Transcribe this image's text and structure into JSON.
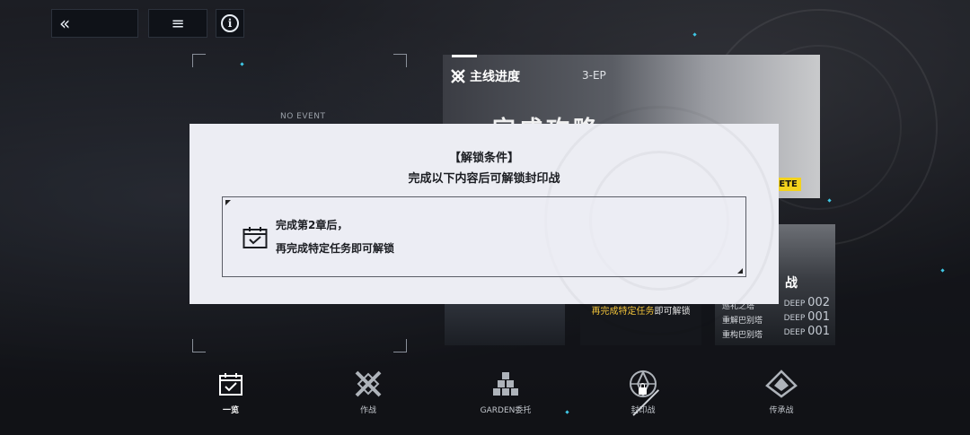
{
  "topbar": {
    "back_label": "«",
    "menu_label": "≡",
    "info_label": "i"
  },
  "left_area": {
    "no_event": "NO EVENT"
  },
  "main_card": {
    "title": "主线进度",
    "ep": "3-EP",
    "big_text": "完成攻略",
    "badge": "LETE"
  },
  "locked_card": {
    "text_highlight": "再完成特定任务",
    "text_rest": "即可解锁"
  },
  "side_card": {
    "caption": "战",
    "rows": [
      {
        "label": "巡礼之塔",
        "deep_prefix": "DEEP",
        "deep_value": "002"
      },
      {
        "label": "重解巴别塔",
        "deep_prefix": "DEEP",
        "deep_value": "001"
      },
      {
        "label": "重构巴别塔",
        "deep_prefix": "DEEP",
        "deep_value": "001"
      }
    ]
  },
  "dialog": {
    "title": "【解锁条件】",
    "subtitle": "完成以下内容后可解锁封印战",
    "condition_line1": "完成第2章后，",
    "condition_line2": "再完成特定任务即可解锁"
  },
  "bottom_nav": [
    {
      "label": "一览",
      "icon": "calendar-check-icon",
      "active": true
    },
    {
      "label": "作战",
      "icon": "crossed-swords-icon",
      "active": false
    },
    {
      "label": "GARDEN委托",
      "icon": "blocks-icon",
      "active": false
    },
    {
      "label": "封印战",
      "icon": "seal-icon",
      "active": false,
      "locked": true
    },
    {
      "label": "传承战",
      "icon": "emblem-icon",
      "active": false
    }
  ],
  "colors": {
    "accent_yellow": "#f3d21c",
    "highlight_orange": "#f0c23a",
    "dialog_bg": "#ecedf3",
    "spark_cyan": "#3fc8e6"
  }
}
